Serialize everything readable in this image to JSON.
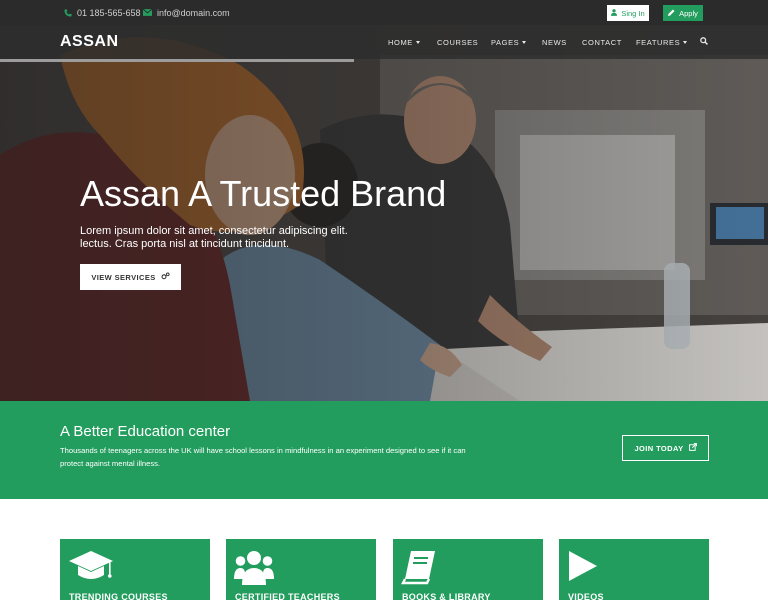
{
  "topbar": {
    "phone": "01 185-565-658",
    "email": "info@domain.com",
    "signin_label": "Sing In",
    "apply_label": "Apply"
  },
  "brand": {
    "logo": "ASSAN"
  },
  "nav": {
    "items": [
      {
        "label": "HOME"
      },
      {
        "label": "COURSES"
      },
      {
        "label": "PAGES"
      },
      {
        "label": "NEWS"
      },
      {
        "label": "CONTACT"
      },
      {
        "label": "FEATURES"
      }
    ]
  },
  "hero": {
    "title": "Assan A Trusted Brand",
    "text_line1": "Lorem ipsum dolor sit amet, consectetur adipiscing elit.",
    "text_line2": "lectus. Cras porta nisl at tincidunt tincidunt.",
    "button_label": "VIEW SERVICES"
  },
  "band": {
    "title": "A Better Education center",
    "text_line1": "Thousands of teenagers across the UK will have school lessons in mindfulness in an experiment designed to see if it can",
    "text_line2": "protect against mental illness.",
    "button_label": "JOIN TODAY"
  },
  "cards": [
    {
      "label": "TRENDING COURSES",
      "icon": "graduation-cap-icon"
    },
    {
      "label": "CERTIFIED TEACHERS",
      "icon": "users-icon"
    },
    {
      "label": "BOOKS & LIBRARY",
      "icon": "book-icon"
    },
    {
      "label": "VIDEOS",
      "icon": "play-icon"
    }
  ],
  "colors": {
    "accent": "#239d5e",
    "topbar_bg": "#2b2b2b",
    "nav_bg": "#2d2d2d"
  }
}
